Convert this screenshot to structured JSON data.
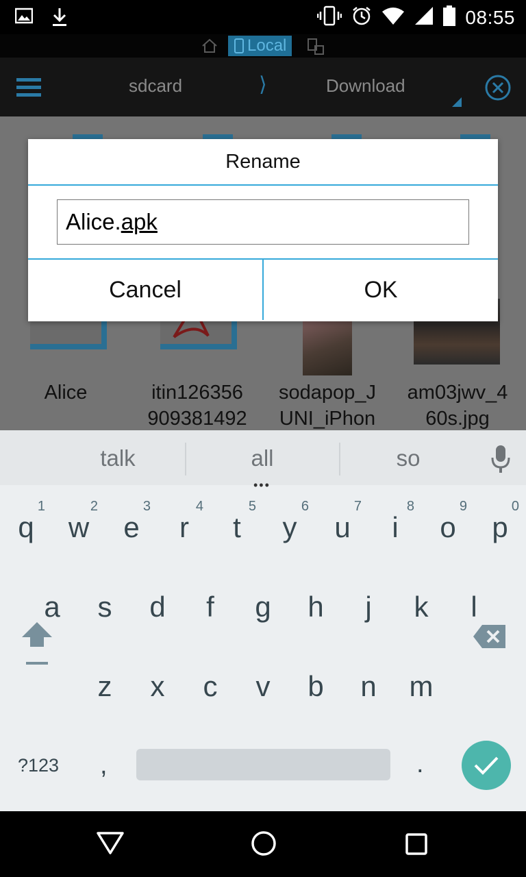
{
  "status_bar": {
    "time": "08:55",
    "icons": [
      "image-icon",
      "download-icon",
      "vibrate-icon",
      "alarm-icon",
      "wifi-icon",
      "signal-icon",
      "battery-icon"
    ]
  },
  "header": {
    "mode_tab_label": "Local",
    "breadcrumb": [
      "sdcard",
      "Download"
    ]
  },
  "files": [
    {
      "name_line1": "Alice",
      "name_line2": ""
    },
    {
      "name_line1": "itin126356",
      "name_line2": "909381492"
    },
    {
      "name_line1": "sodapop_J",
      "name_line2": "UNI_iPhon"
    },
    {
      "name_line1": "am03jwv_4",
      "name_line2": "60s.jpg"
    }
  ],
  "dialog": {
    "title": "Rename",
    "input_prefix": "Alice.",
    "input_underlined": "apk",
    "cancel_label": "Cancel",
    "ok_label": "OK"
  },
  "keyboard": {
    "suggestions": [
      "talk",
      "all",
      "so"
    ],
    "row1": [
      {
        "ch": "q",
        "hint": "1"
      },
      {
        "ch": "w",
        "hint": "2"
      },
      {
        "ch": "e",
        "hint": "3"
      },
      {
        "ch": "r",
        "hint": "4"
      },
      {
        "ch": "t",
        "hint": "5"
      },
      {
        "ch": "y",
        "hint": "6"
      },
      {
        "ch": "u",
        "hint": "7"
      },
      {
        "ch": "i",
        "hint": "8"
      },
      {
        "ch": "o",
        "hint": "9"
      },
      {
        "ch": "p",
        "hint": "0"
      }
    ],
    "row2": [
      "a",
      "s",
      "d",
      "f",
      "g",
      "h",
      "j",
      "k",
      "l"
    ],
    "row3": [
      "z",
      "x",
      "c",
      "v",
      "b",
      "n",
      "m"
    ],
    "symbols_label": "?123",
    "comma": ",",
    "period": ".",
    "accent_color": "#4db6ac"
  },
  "colors": {
    "dialog_divider": "#35a9da",
    "header_accent": "#2a7aa6"
  }
}
